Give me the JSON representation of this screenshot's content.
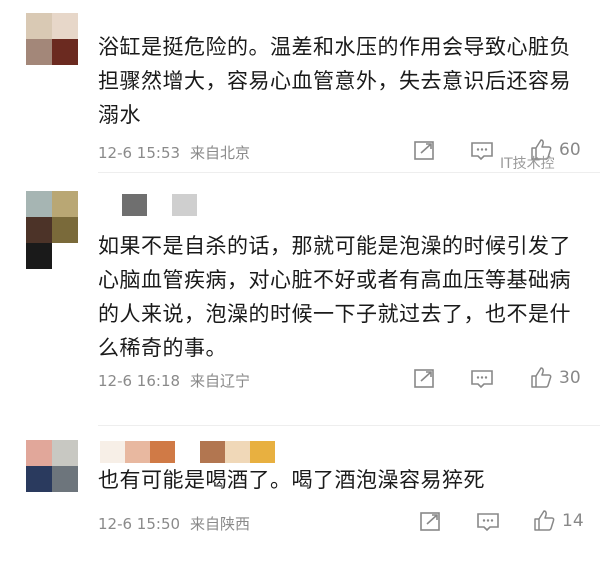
{
  "comments": [
    {
      "text": "浴缸是挺危险的。温差和水压的作用会导致心脏负担骤然增大，容易心血管意外，失去意识后还容易溺水",
      "date": "12-6 15:53",
      "location": "来自北京",
      "likes": "60",
      "avatar_colors": [
        "#d9c9b4",
        "#e7d7c9",
        "#a38779",
        "#6b2a20"
      ],
      "name_colors": []
    },
    {
      "text": "如果不是自杀的话，那就可能是泡澡的时候引发了心脑血管疾病，对心脏不好或者有高血压等基础病的人来说，泡澡的时候一下子就过去了，也不是什么稀奇的事。",
      "date": "12-6 16:18",
      "location": "来自辽宁",
      "likes": "30",
      "avatar_colors": [
        "#a6b5b3",
        "#b9a774",
        "#4c3328",
        "#7a6a3a",
        "#1a1a1a"
      ],
      "name_colors": [
        "#6f6f6f",
        "#ffffff",
        "#cfcfcf"
      ]
    },
    {
      "text": "也有可能是喝酒了。喝了酒泡澡容易猝死",
      "date": "12-6 15:50",
      "location": "来自陕西",
      "likes": "14",
      "avatar_colors": [
        "#e1a79a",
        "#c8c8c2",
        "#2a3a5e",
        "#6d757c"
      ],
      "name_colors": [
        "#f7efe7",
        "#e8b8a0",
        "#d07a46",
        "#ffffff",
        "#b27650",
        "#f0d8b8",
        "#e8b040"
      ]
    }
  ],
  "overlay_label": "IT技术控"
}
